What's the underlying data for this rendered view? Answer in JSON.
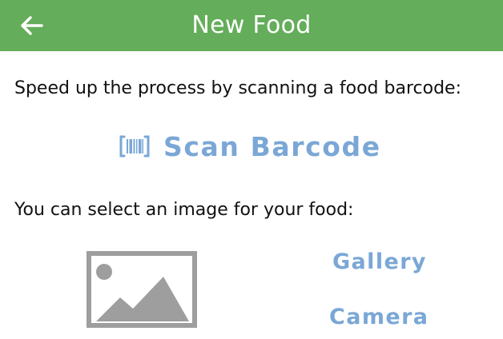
{
  "header": {
    "title": "New Food",
    "back_icon": "arrow-left-icon",
    "background_color": "#64ad5a"
  },
  "scan": {
    "prompt": "Speed up the process by scanning a food barcode:",
    "button_label": "Scan Barcode",
    "icon": "barcode-icon",
    "accent_color": "#7aa7d6"
  },
  "image": {
    "prompt": "You can select an image for your food:",
    "placeholder_icon": "image-placeholder-icon",
    "gallery_label": "Gallery",
    "camera_label": "Camera"
  }
}
